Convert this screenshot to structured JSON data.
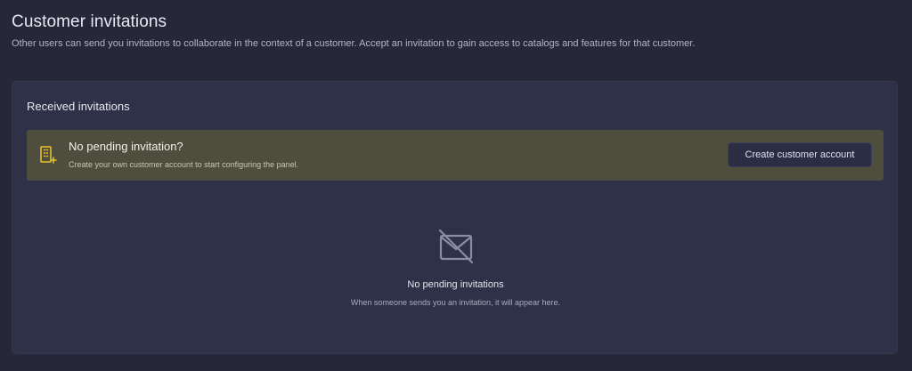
{
  "header": {
    "title": "Customer invitations",
    "description": "Other users can send you invitations to collaborate in the context of a customer. Accept an invitation to gain access to catalogs and features for that customer."
  },
  "received": {
    "title": "Received invitations",
    "banner": {
      "icon": "building-add-icon",
      "title": "No pending invitation?",
      "subtitle": "Create your own customer account to start configuring the panel.",
      "button_label": "Create customer account"
    },
    "empty_state": {
      "icon": "mail-off-icon",
      "title": "No pending invitations",
      "subtitle": "When someone sends you an invitation, it will appear here."
    }
  },
  "colors": {
    "background": "#262839",
    "card": "#2f3148",
    "banner": "#4f4e3e",
    "accent_yellow": "#e8c62c"
  }
}
